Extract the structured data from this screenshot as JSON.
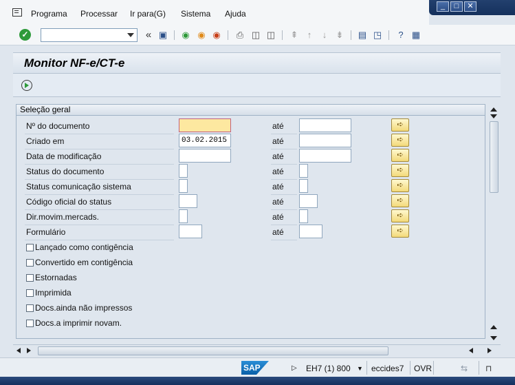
{
  "menu": {
    "items": [
      "Programa",
      "Processar",
      "Ir para(G)",
      "Sistema",
      "Ajuda"
    ]
  },
  "toolbar": {
    "command_value": "",
    "icons": [
      "enter-icon",
      "save-icon",
      "back-icon",
      "exit-icon",
      "cancel-icon",
      "print-icon",
      "find-icon",
      "find-next-icon",
      "first-page-icon",
      "previous-page-icon",
      "next-page-icon",
      "last-page-icon",
      "create-session-icon",
      "shortcut-icon",
      "help-icon",
      "customize-layout-icon"
    ]
  },
  "screen": {
    "title": "Monitor NF-e/CT-e"
  },
  "group": {
    "title": "Seleção geral",
    "ate_label": "até",
    "rows": [
      {
        "label": "Nº do documento",
        "from": "",
        "to": ""
      },
      {
        "label": "Criado em",
        "from": "03.02.2015",
        "to": ""
      },
      {
        "label": "Data de modificação",
        "from": "",
        "to": ""
      },
      {
        "label": "Status do documento",
        "from": "",
        "to": ""
      },
      {
        "label": "Status comunicação sistema",
        "from": "",
        "to": ""
      },
      {
        "label": "Código oficial do status",
        "from": "",
        "to": ""
      },
      {
        "label": "Dir.movim.mercads.",
        "from": "",
        "to": ""
      },
      {
        "label": "Formulário",
        "from": "",
        "to": ""
      }
    ],
    "checkboxes": [
      {
        "label": "Lançado como contigência",
        "checked": false
      },
      {
        "label": "Convertido em contigência",
        "checked": false
      },
      {
        "label": "Estornadas",
        "checked": false
      },
      {
        "label": "Imprimida",
        "checked": false
      },
      {
        "label": "Docs.ainda não impressos",
        "checked": false
      },
      {
        "label": "Docs.a imprimir novam.",
        "checked": false
      }
    ]
  },
  "status": {
    "logo": "SAP",
    "system": "EH7 (1) 800",
    "server": "eccides7",
    "mode": "OVR"
  },
  "colors": {
    "accent_blue": "#1a3a6c",
    "multi_button": "#f3d97a",
    "focus_field": "#fde8a0"
  }
}
